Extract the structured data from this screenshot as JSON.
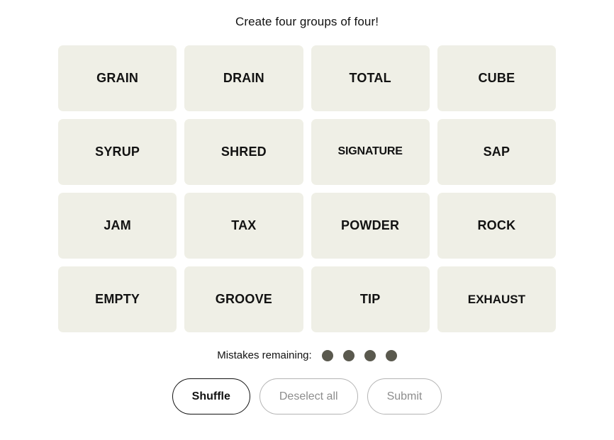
{
  "header": {
    "instruction": "Create four groups of four!"
  },
  "board": {
    "rows": [
      {
        "tiles": [
          {
            "label": "GRAIN",
            "selected": false
          },
          {
            "label": "DRAIN",
            "selected": false
          },
          {
            "label": "TOTAL",
            "selected": false
          },
          {
            "label": "CUBE",
            "selected": false
          }
        ]
      },
      {
        "tiles": [
          {
            "label": "SYRUP",
            "selected": false
          },
          {
            "label": "SHRED",
            "selected": false
          },
          {
            "label": "SIGNATURE",
            "selected": false
          },
          {
            "label": "SAP",
            "selected": false
          }
        ]
      },
      {
        "tiles": [
          {
            "label": "JAM",
            "selected": false
          },
          {
            "label": "TAX",
            "selected": false
          },
          {
            "label": "POWDER",
            "selected": false
          },
          {
            "label": "ROCK",
            "selected": false
          }
        ]
      },
      {
        "tiles": [
          {
            "label": "EMPTY",
            "selected": false
          },
          {
            "label": "GROOVE",
            "selected": false
          },
          {
            "label": "TIP",
            "selected": false
          },
          {
            "label": "EXHAUST",
            "selected": false
          }
        ]
      }
    ]
  },
  "mistakes": {
    "label": "Mistakes remaining:",
    "remaining": 4,
    "dot_color": "#5a594e"
  },
  "actions": {
    "shuffle_label": "Shuffle",
    "deselect_label": "Deselect all",
    "submit_label": "Submit",
    "shuffle_enabled": true,
    "deselect_enabled": false,
    "submit_enabled": false
  },
  "colors": {
    "page_background": "#ffffff",
    "tile_background": "#efefe6",
    "tile_text": "#121212",
    "disabled_text": "#8d8d8d",
    "disabled_border": "#b4b4b4"
  }
}
